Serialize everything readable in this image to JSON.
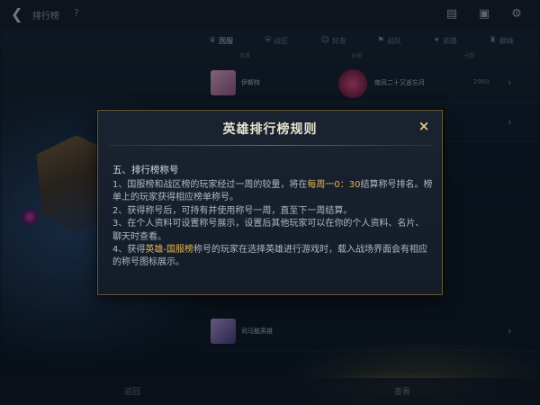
{
  "background": {
    "topbar": {
      "title": "排行榜",
      "help": "?"
    },
    "tabs": [
      {
        "label": "国服",
        "icon": "crown-icon",
        "active": true
      },
      {
        "label": "战区",
        "icon": "shield-icon",
        "active": false
      },
      {
        "label": "好友",
        "icon": "friends-icon",
        "active": false
      },
      {
        "label": "战队",
        "icon": "team-icon",
        "active": false
      },
      {
        "label": "英雄",
        "icon": "hero-icon",
        "active": false
      },
      {
        "label": "巅峰",
        "icon": "trophy-icon",
        "active": false
      }
    ],
    "list_header": [
      "英雄",
      "玩家",
      "分数"
    ],
    "rows": [
      {
        "hero_name": "伊斯特",
        "player_name": "南风二十又逝忘月",
        "score": "2960"
      },
      {
        "hero_name": "",
        "player_name": "",
        "score": ""
      },
      {
        "hero_name": "司马懿英雄",
        "player_name": "",
        "score": ""
      }
    ],
    "bottom_nav": [
      "返回",
      "查看"
    ]
  },
  "modal": {
    "title": "英雄排行榜规则",
    "close_label": "×",
    "section_heading": "五、排行榜称号",
    "rules": [
      [
        {
          "t": "1、国服榜和战区榜的玩家经过一周的较量，将在",
          "h": false
        },
        {
          "t": "每周一0：30",
          "h": true
        },
        {
          "t": "结算称号排名。榜单上的玩家获得相应榜单称号。",
          "h": false
        }
      ],
      [
        {
          "t": "2、获得称号后，可持有并使用称号一周，直至下一周结算。",
          "h": false
        }
      ],
      [
        {
          "t": "3、在个人资料可设置称号展示，设置后其他玩家可以在你的个人资料、名片、聊天时查看。",
          "h": false
        }
      ],
      [
        {
          "t": "4、获得",
          "h": false
        },
        {
          "t": "英雄-国服榜",
          "h": true
        },
        {
          "t": "称号的玩家在选择英雄进行游戏时，载入战场界面会有相应的称号图标展示。",
          "h": false
        }
      ]
    ]
  },
  "colors": {
    "highlight": "#e3b553",
    "border_gold": "#6b5a35",
    "close": "#e7c879"
  }
}
